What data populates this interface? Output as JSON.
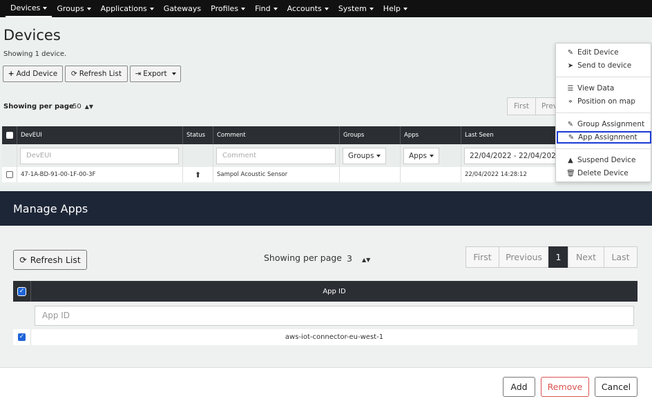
{
  "nav": {
    "items": [
      "Devices",
      "Groups",
      "Applications",
      "Gateways",
      "Profiles",
      "Find",
      "Accounts",
      "System",
      "Help"
    ],
    "has_caret": [
      true,
      true,
      true,
      false,
      true,
      true,
      true,
      true,
      true
    ]
  },
  "devices_page": {
    "title": "Devices",
    "showing": "Showing 1 device.",
    "add_device": "Add Device",
    "refresh_list": "Refresh List",
    "export": "Export",
    "showing_per_page": "Showing per page",
    "per_page_value": "50",
    "pagination": [
      "First",
      "Prev"
    ],
    "table": {
      "headers": [
        "DevEUI",
        "Status",
        "Comment",
        "Groups",
        "Apps",
        "Last Seen"
      ],
      "filter_deveui": "DevEUI",
      "filter_comment": "Comment",
      "filter_groups": "Groups",
      "filter_apps": "Apps",
      "filter_lastseen": "22/04/2022 - 22/04/202",
      "row": {
        "deveui": "47-1A-BD-91-00-1F-00-3F",
        "comment": "Sampol Acoustic Sensor",
        "last_seen": "22/04/2022 14:28:12"
      }
    }
  },
  "dropdown": {
    "edit_device": "Edit Device",
    "send_to_device": "Send to device",
    "view_data": "View Data",
    "position_on_map": "Position on map",
    "group_assignment": "Group Assignment",
    "app_assignment": "App Assignment",
    "suspend_device": "Suspend Device",
    "delete_device": "Delete Device"
  },
  "modal": {
    "title": "Manage Apps",
    "refresh_list": "Refresh List",
    "showing_per_page": "Showing per page",
    "per_page_value": "3",
    "pagination": {
      "first": "First",
      "previous": "Previous",
      "page": "1",
      "next": "Next",
      "last": "Last"
    },
    "table": {
      "header": "App ID",
      "filter_placeholder": "App ID",
      "rows": [
        "aws-iot-connector-eu-west-1"
      ]
    },
    "footer": {
      "add": "Add",
      "remove": "Remove",
      "cancel": "Cancel"
    },
    "colors": {
      "remove": "#d9534f",
      "header_bg": "#1d2637",
      "checkbox": "#1e64d8",
      "highlight": "#1a3ad6"
    }
  }
}
